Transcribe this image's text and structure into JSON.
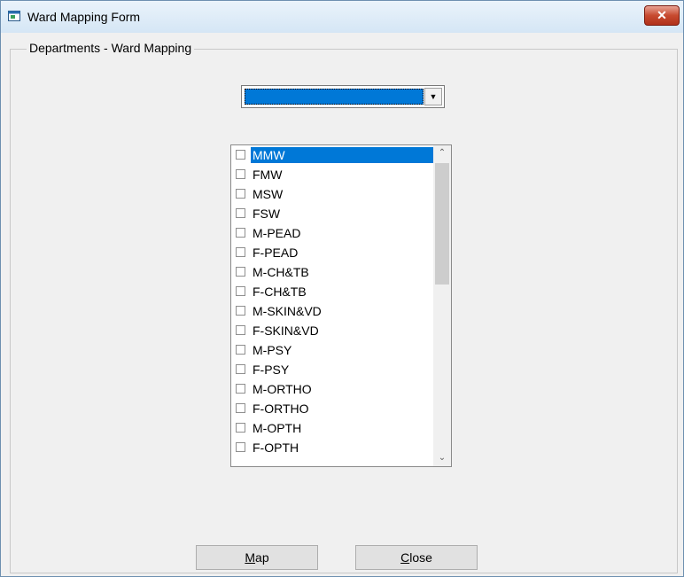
{
  "window": {
    "title": "Ward  Mapping Form",
    "close_glyph": "✕"
  },
  "group": {
    "label": "Departments - Ward Mapping"
  },
  "combo": {
    "selected": "",
    "arrow_glyph": "▼"
  },
  "listbox": {
    "items": [
      {
        "label": "MMW",
        "checked": false,
        "selected": true
      },
      {
        "label": "FMW",
        "checked": false,
        "selected": false
      },
      {
        "label": "MSW",
        "checked": false,
        "selected": false
      },
      {
        "label": "FSW",
        "checked": false,
        "selected": false
      },
      {
        "label": "M-PEAD",
        "checked": false,
        "selected": false
      },
      {
        "label": "F-PEAD",
        "checked": false,
        "selected": false
      },
      {
        "label": "M-CH&TB",
        "checked": false,
        "selected": false
      },
      {
        "label": "F-CH&TB",
        "checked": false,
        "selected": false
      },
      {
        "label": "M-SKIN&VD",
        "checked": false,
        "selected": false
      },
      {
        "label": "F-SKIN&VD",
        "checked": false,
        "selected": false
      },
      {
        "label": "M-PSY",
        "checked": false,
        "selected": false
      },
      {
        "label": "F-PSY",
        "checked": false,
        "selected": false
      },
      {
        "label": "M-ORTHO",
        "checked": false,
        "selected": false
      },
      {
        "label": "F-ORTHO",
        "checked": false,
        "selected": false
      },
      {
        "label": "M-OPTH",
        "checked": false,
        "selected": false
      },
      {
        "label": "F-OPTH",
        "checked": false,
        "selected": false
      }
    ],
    "scroll_up_glyph": "⌃",
    "scroll_down_glyph": "⌄"
  },
  "buttons": {
    "map": {
      "accel": "M",
      "rest": "ap"
    },
    "close": {
      "accel": "C",
      "rest": "lose"
    }
  },
  "colors": {
    "selection": "#0078d7",
    "close_button": "#c74a2f"
  }
}
